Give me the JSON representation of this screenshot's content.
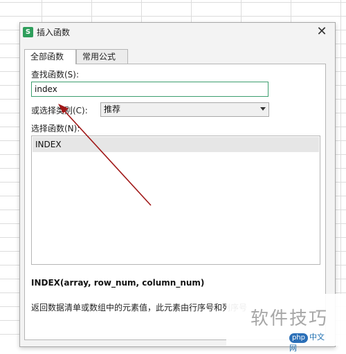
{
  "dialog": {
    "title": "插入函数",
    "app_icon": "S",
    "close_glyph": "✕"
  },
  "tabs": [
    {
      "label": "全部函数",
      "active": true
    },
    {
      "label": "常用公式",
      "active": false
    }
  ],
  "search": {
    "label": "查找函数(S):",
    "value": "index"
  },
  "category": {
    "label": "或选择类别(C):",
    "selected": "推荐"
  },
  "function_list": {
    "label": "选择函数(N):",
    "items": [
      "INDEX"
    ],
    "selected_index": 0
  },
  "signature": "INDEX(array, row_num, column_num)",
  "description": "返回数据清单或数组中的元素值，此元素由行序号和列序号",
  "watermark": {
    "text": "软件技巧",
    "logo_php": "php",
    "logo_suffix": "中文网"
  },
  "colors": {
    "annotation_arrow": "#a01818",
    "input_focus_border": "#3c9e6e",
    "app_icon": "#2e9e5b"
  }
}
